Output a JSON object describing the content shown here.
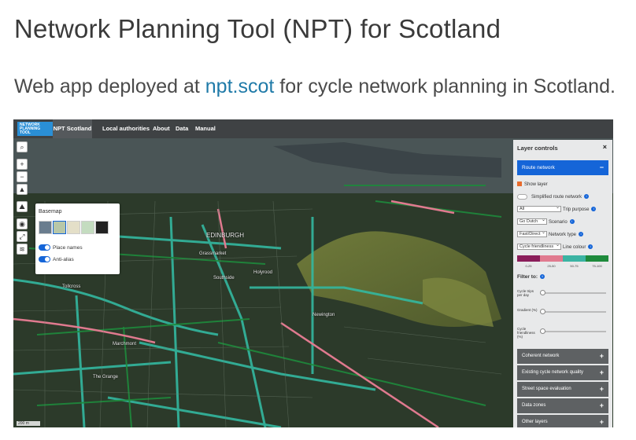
{
  "page": {
    "title": "Network Planning Tool (NPT) for Scotland",
    "subtitle_pre": "Web app deployed at ",
    "subtitle_link": "npt.scot",
    "subtitle_post": " for cycle network planning in Scotland."
  },
  "app": {
    "logo_text": "NETWORK\nPLANNING\nTOOL",
    "nav": {
      "home": "NPT Scotland",
      "local_authorities": "Local authorities",
      "about": "About",
      "data": "Data",
      "manual": "Manual"
    },
    "map_tools": [
      "search-icon",
      "zoom-in-icon",
      "zoom-out-icon",
      "compass-icon",
      "terrain-icon",
      "locate-icon",
      "fullscreen-icon",
      "layers-icon"
    ],
    "tool_glyphs": [
      "⌕",
      "+",
      "−",
      "▲",
      "⛰",
      "◉",
      "⤢",
      "≋"
    ],
    "basemap": {
      "title": "Basemap",
      "toggles": [
        {
          "label": "Place names",
          "on": true
        },
        {
          "label": "Anti-alias",
          "on": true
        }
      ]
    },
    "map_labels": [
      "EDINBURGH",
      "Tollcross",
      "Marchmont",
      "The Grange",
      "Grassmarket",
      "Southside",
      "Newington",
      "Holyrood"
    ],
    "scale": "200 m",
    "layer_controls": {
      "title": "Layer controls",
      "close": "×",
      "route_network": "Route network",
      "route_network_icon": "−",
      "show_layer": "Show layer",
      "simplified": "Simplified route network",
      "trip_purpose": {
        "value": "All",
        "label": "Trip purpose"
      },
      "scenario": {
        "value": "Go Dutch",
        "label": "Scenario"
      },
      "network_type": {
        "value": "Fast/Direct",
        "label": "Network type"
      },
      "line_colour": {
        "value": "Cycle friendliness",
        "label": "Line colour"
      },
      "legend_colors": [
        "#8a1d5a",
        "#e07a8f",
        "#3bb3a3",
        "#1e8a3c"
      ],
      "legend_values": [
        "0-25",
        "25-50",
        "50-75",
        "75-100"
      ],
      "filter_to": "Filter to:",
      "filters": [
        {
          "label": "Cycle trips per day",
          "level": 0.0
        },
        {
          "label": "Gradient (%)",
          "level": 0.0
        },
        {
          "label": "Cycle friendliness (%)",
          "level": 0.0
        }
      ],
      "sections": [
        "Coherent network",
        "Existing cycle network quality",
        "Street space evaluation",
        "Data zones",
        "Other layers"
      ],
      "section_icon": "+"
    }
  }
}
